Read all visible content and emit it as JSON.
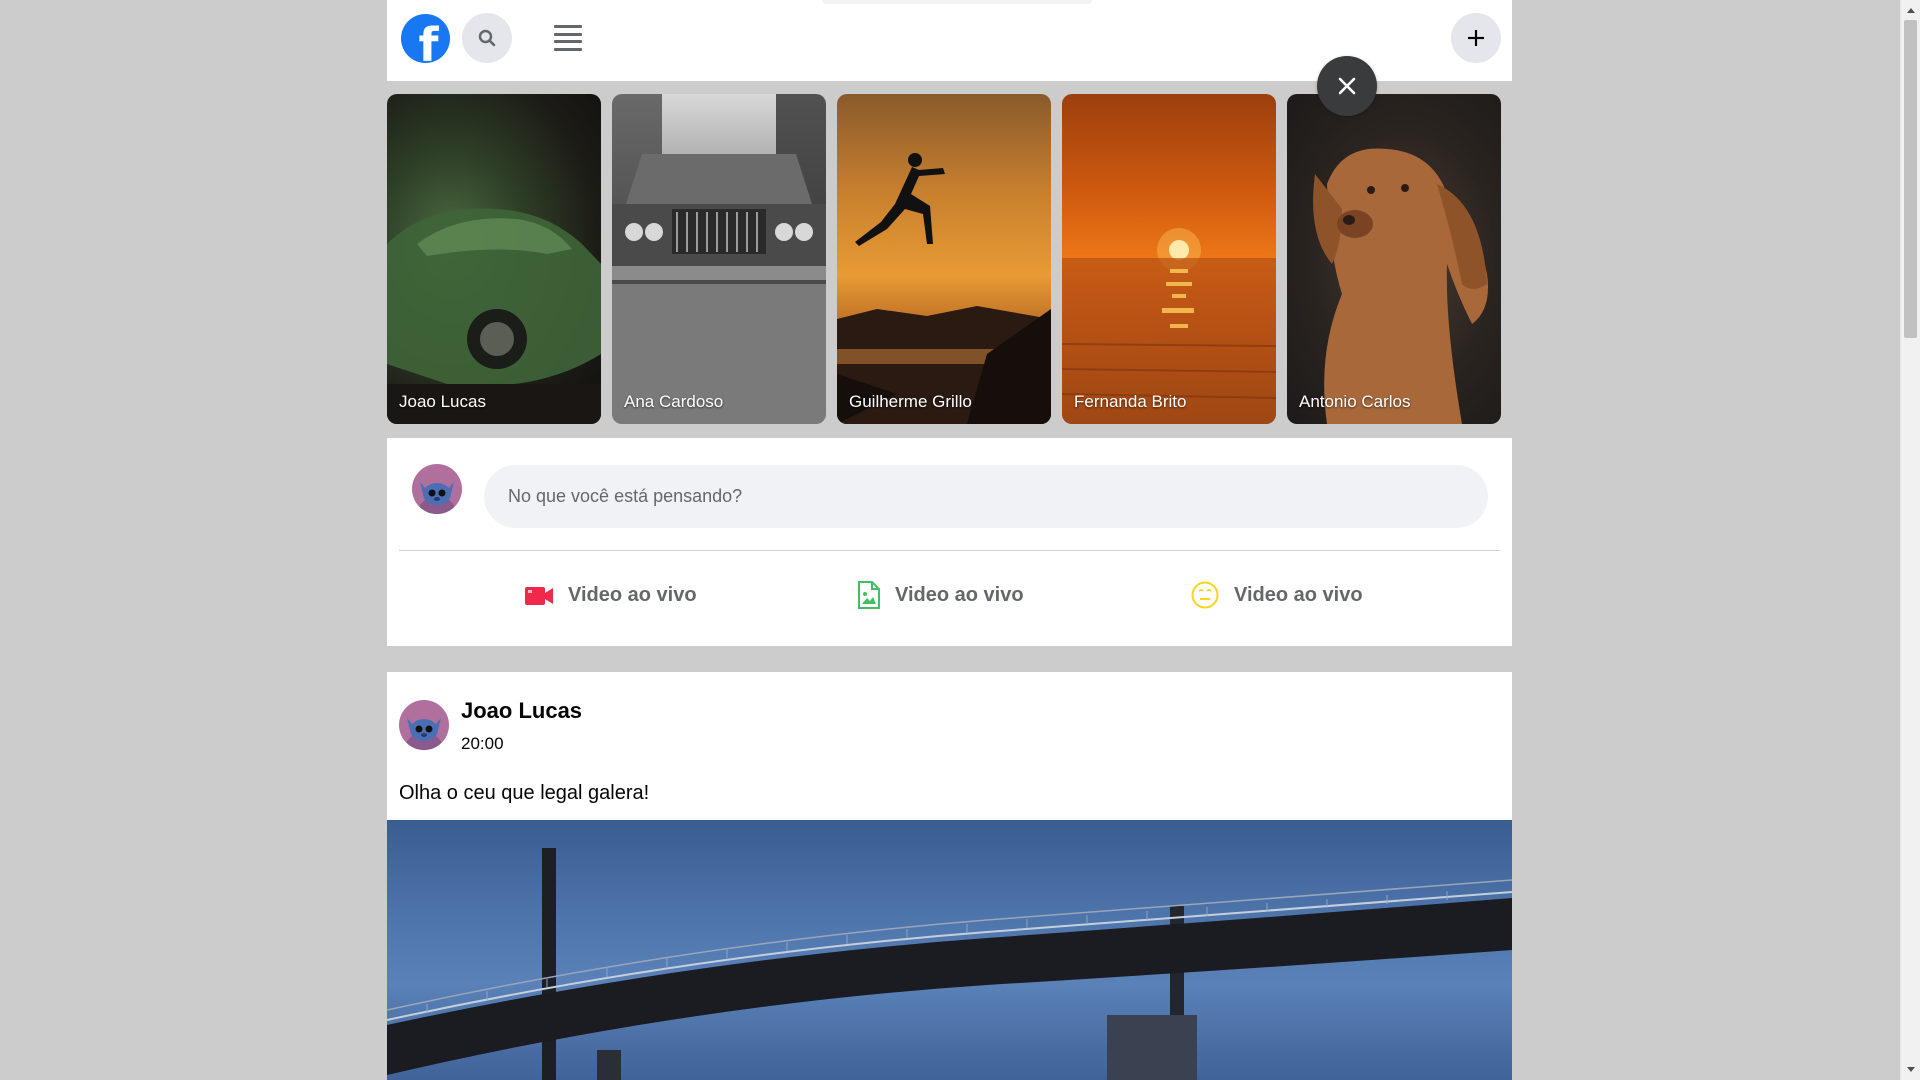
{
  "header": {
    "logo_letter": "f",
    "logo_color": "#1877f2"
  },
  "stories": [
    {
      "name": "Joao Lucas"
    },
    {
      "name": "Ana Cardoso"
    },
    {
      "name": "Guilherme Grillo"
    },
    {
      "name": "Fernanda Brito"
    },
    {
      "name": "Antonio Carlos"
    }
  ],
  "composer": {
    "placeholder": "No que você está pensando?",
    "actions": [
      {
        "label": "Video ao vivo",
        "icon": "video-camera-icon",
        "color": "#f02849"
      },
      {
        "label": "Video ao vivo",
        "icon": "photo-file-icon",
        "color": "#45bd62"
      },
      {
        "label": "Video ao vivo",
        "icon": "smiley-face-icon",
        "color": "#f7d51d"
      }
    ]
  },
  "post": {
    "author": "Joao Lucas",
    "time": "20:00",
    "text": "Olha o ceu que legal galera!"
  }
}
